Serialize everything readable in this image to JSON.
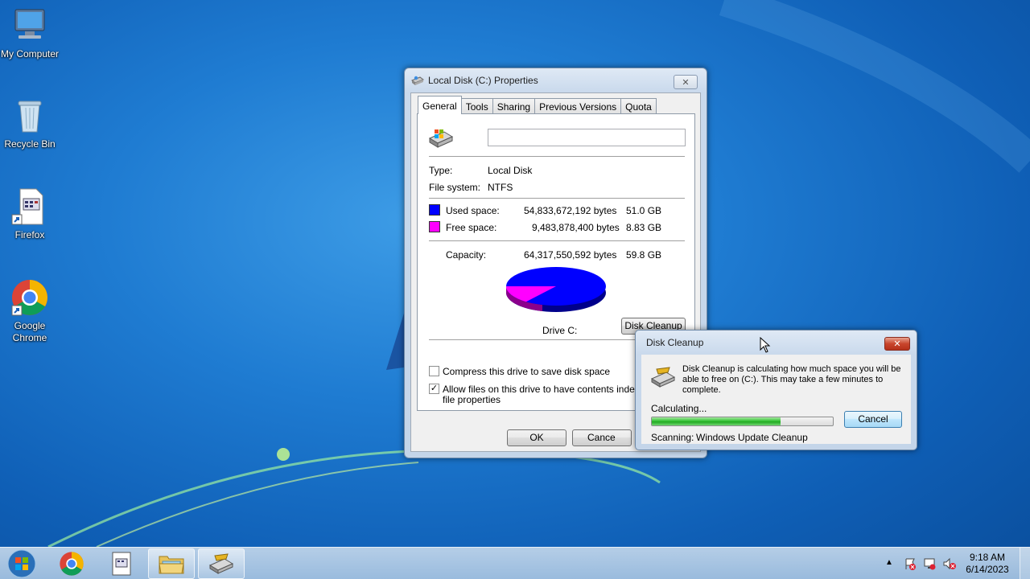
{
  "desktop": {
    "icons": [
      {
        "label": "My Computer"
      },
      {
        "label": "Recycle Bin"
      },
      {
        "label": "Firefox"
      },
      {
        "label": "Google Chrome"
      }
    ]
  },
  "properties_window": {
    "title": "Local Disk (C:) Properties",
    "tabs": [
      "General",
      "Tools",
      "Sharing",
      "Previous Versions",
      "Quota"
    ],
    "active_tab": "General",
    "drive_name_value": "",
    "type_label": "Type:",
    "type_value": "Local Disk",
    "fs_label": "File system:",
    "fs_value": "NTFS",
    "used_label": "Used space:",
    "used_bytes": "54,833,672,192 bytes",
    "used_gb": "51.0 GB",
    "used_color": "#0000ff",
    "free_label": "Free space:",
    "free_bytes": "9,483,878,400 bytes",
    "free_gb": "8.83 GB",
    "free_color": "#ff00ff",
    "capacity_label": "Capacity:",
    "capacity_bytes": "64,317,550,592 bytes",
    "capacity_gb": "59.8 GB",
    "drive_caption": "Drive C:",
    "disk_cleanup_button": "Disk Cleanup",
    "compress_label": "Compress this drive to save disk space",
    "compress_checked": false,
    "index_label_line1": "Allow files on this drive to have contents indexed in",
    "index_label_line2": "file properties",
    "index_checked": true,
    "ok_button": "OK",
    "cancel_button": "Cance"
  },
  "disk_cleanup_dialog": {
    "title": "Disk Cleanup",
    "message_line1": "Disk Cleanup is calculating how much space you will be",
    "message_line2": "able to free on  (C:). This may take a few minutes to",
    "message_line3": "complete.",
    "status": "Calculating...",
    "progress": 0.71,
    "cancel_button": "Cancel",
    "scanning_label": "Scanning:",
    "scanning_value": "Windows Update Cleanup"
  },
  "taskbar": {
    "time": "9:18 AM",
    "date": "6/14/2023",
    "items": [
      "start-orb",
      "chrome",
      "app",
      "explorer",
      "disk-cleanup"
    ]
  }
}
